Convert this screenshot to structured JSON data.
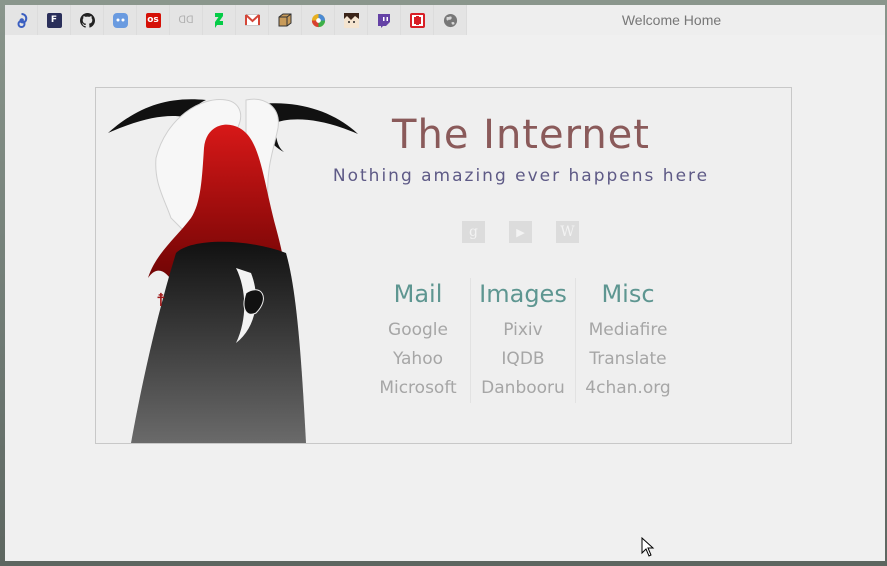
{
  "window": {
    "title": "Welcome Home"
  },
  "bookmarks": [
    {
      "name": "swirl-icon",
      "glyph": "",
      "color": "#3b5fc0"
    },
    {
      "name": "fictionpress-icon",
      "glyph": "F",
      "color": "#2a2f5a"
    },
    {
      "name": "github-icon",
      "glyph": "",
      "color": "#222222"
    },
    {
      "name": "robot-icon",
      "glyph": "",
      "color": "#6a9be0"
    },
    {
      "name": "lastfm-icon",
      "glyph": "os",
      "color": "#d51007"
    },
    {
      "name": "link-icon",
      "glyph": "",
      "color": "#b0b0b0"
    },
    {
      "name": "deviantart-icon",
      "glyph": "",
      "color": "#05cc47"
    },
    {
      "name": "gmail-icon",
      "glyph": "M",
      "color": "#d44638"
    },
    {
      "name": "box-icon",
      "glyph": "",
      "color": "#7a5a2a"
    },
    {
      "name": "picasa-icon",
      "glyph": "",
      "color": "#e0a020"
    },
    {
      "name": "anime-avatar-icon",
      "glyph": "",
      "color": "#7a4030"
    },
    {
      "name": "twitch-icon",
      "glyph": "",
      "color": "#6441a5"
    },
    {
      "name": "netflix-icon",
      "glyph": "",
      "color": "#d81f26"
    },
    {
      "name": "globe-icon",
      "glyph": "",
      "color": "#777777"
    }
  ],
  "page": {
    "title": "The Internet",
    "subtitle": "Nothing amazing ever happens here",
    "social": [
      {
        "name": "google-plus-icon",
        "glyph": "g"
      },
      {
        "name": "youtube-icon",
        "glyph": "▶"
      },
      {
        "name": "wikipedia-icon",
        "glyph": "W"
      }
    ],
    "columns": [
      {
        "heading": "Mail",
        "links": [
          "Google",
          "Yahoo",
          "Microsoft"
        ]
      },
      {
        "heading": "Images",
        "links": [
          "Pixiv",
          "IQDB",
          "Danbooru"
        ]
      },
      {
        "heading": "Misc",
        "links": [
          "Mediafire",
          "Translate",
          "4chan.org"
        ]
      }
    ]
  },
  "colors": {
    "title": "#8a5a5a",
    "subtitle": "#5e5a86",
    "heading": "#5e9691",
    "link": "#a6a6a6"
  }
}
